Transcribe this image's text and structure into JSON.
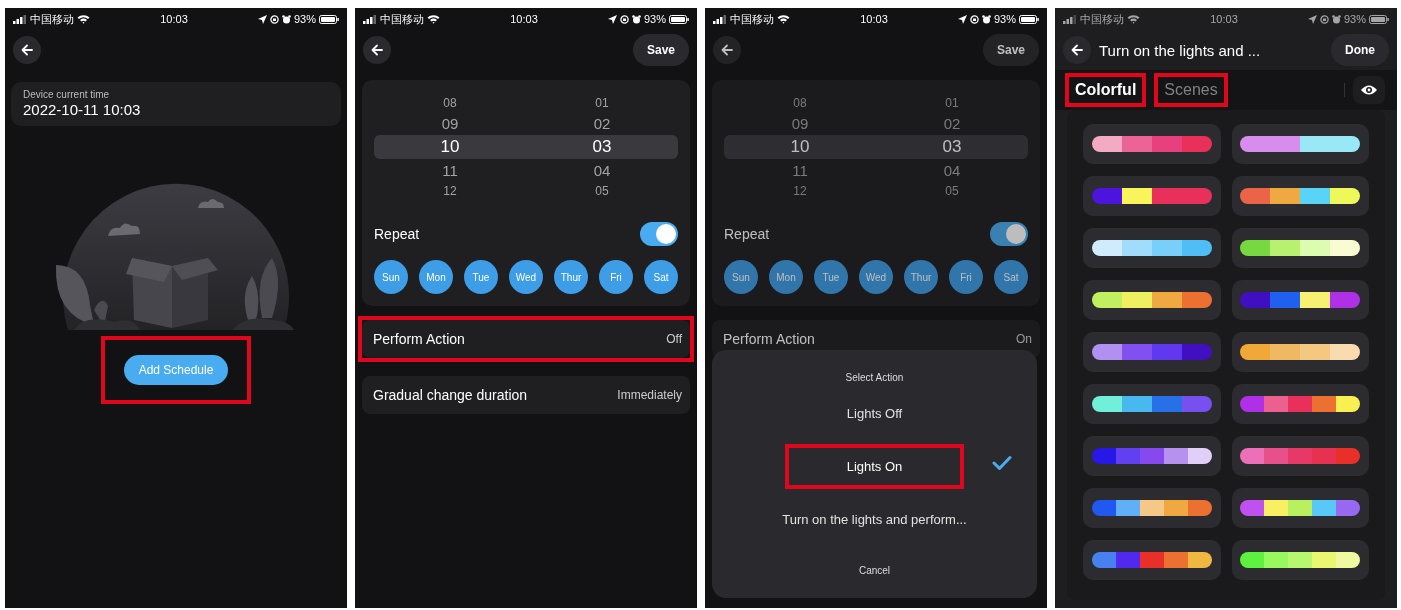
{
  "screens": [
    {
      "kind": "schedule_empty",
      "status_bar": {
        "carrier": "中国移动",
        "time": "10:03",
        "battery": "93%",
        "dimmed": false
      },
      "device_time": {
        "label": "Device current time",
        "value": "2022-10-11 10:03"
      },
      "add_button": {
        "label": "Add Schedule",
        "highlighted": true
      }
    },
    {
      "kind": "schedule_edit",
      "status_bar": {
        "carrier": "中国移动",
        "time": "10:03",
        "battery": "93%",
        "dimmed": false
      },
      "save_label": "Save",
      "picker": {
        "hours": [
          {
            "value": "08",
            "selected": false
          },
          {
            "value": "09",
            "selected": false
          },
          {
            "value": "10",
            "selected": true
          },
          {
            "value": "11",
            "selected": false
          },
          {
            "value": "12",
            "selected": false
          }
        ],
        "minutes": [
          {
            "value": "01",
            "selected": false
          },
          {
            "value": "02",
            "selected": false
          },
          {
            "value": "03",
            "selected": true
          },
          {
            "value": "04",
            "selected": false
          },
          {
            "value": "05",
            "selected": false
          }
        ]
      },
      "repeat": {
        "label": "Repeat",
        "on": true
      },
      "days": [
        {
          "label": "Sun",
          "selected": true
        },
        {
          "label": "Mon",
          "selected": true
        },
        {
          "label": "Tue",
          "selected": true
        },
        {
          "label": "Wed",
          "selected": true
        },
        {
          "label": "Thur",
          "selected": true
        },
        {
          "label": "Fri",
          "selected": true
        },
        {
          "label": "Sat",
          "selected": true
        }
      ],
      "rows": [
        {
          "label": "Perform Action",
          "value": "Off",
          "highlighted": true
        },
        {
          "label": "Gradual change duration",
          "value": "Immediately",
          "highlighted": false
        }
      ]
    },
    {
      "kind": "action_sheet",
      "status_bar": {
        "carrier": "中国移动",
        "time": "10:03",
        "battery": "93%",
        "dimmed": false
      },
      "save_label": "Save",
      "picker": {
        "hours": [
          {
            "value": "08",
            "selected": false
          },
          {
            "value": "09",
            "selected": false
          },
          {
            "value": "10",
            "selected": true
          },
          {
            "value": "11",
            "selected": false
          },
          {
            "value": "12",
            "selected": false
          }
        ],
        "minutes": [
          {
            "value": "01",
            "selected": false
          },
          {
            "value": "02",
            "selected": false
          },
          {
            "value": "03",
            "selected": true
          },
          {
            "value": "04",
            "selected": false
          },
          {
            "value": "05",
            "selected": false
          }
        ]
      },
      "repeat": {
        "label": "Repeat",
        "on": true
      },
      "days": [
        {
          "label": "Sun",
          "selected": true
        },
        {
          "label": "Mon",
          "selected": true
        },
        {
          "label": "Tue",
          "selected": true
        },
        {
          "label": "Wed",
          "selected": true
        },
        {
          "label": "Thur",
          "selected": true
        },
        {
          "label": "Fri",
          "selected": true
        },
        {
          "label": "Sat",
          "selected": true
        }
      ],
      "rows": [
        {
          "label": "Perform Action",
          "value": "On",
          "highlighted": false
        }
      ],
      "sheet": {
        "title": "Select Action",
        "options": [
          {
            "label": "Lights Off",
            "selected": false,
            "highlighted": false
          },
          {
            "label": "Lights On",
            "selected": true,
            "highlighted": true
          },
          {
            "label": "Turn on the lights and perform...",
            "selected": false,
            "highlighted": false
          }
        ],
        "cancel": "Cancel"
      }
    },
    {
      "kind": "palettes",
      "status_bar": {
        "carrier": "中国移动",
        "time": "10:03",
        "battery": "93%",
        "dimmed": true
      },
      "title": "Turn on the lights and ...",
      "done_label": "Done",
      "tabs": [
        {
          "label": "Colorful",
          "selected": true,
          "highlighted": true
        },
        {
          "label": "Scenes",
          "selected": false,
          "highlighted": true
        }
      ],
      "palettes": [
        {
          "segments": [
            {
              "color": "#f5aac4"
            },
            {
              "color": "#ec6494"
            },
            {
              "color": "#e8407c"
            },
            {
              "color": "#e8305a"
            }
          ]
        },
        {
          "segments": [
            {
              "color": "#d88cf0"
            },
            {
              "color": "#d88cf0"
            },
            {
              "color": "#98e8f8"
            },
            {
              "color": "#98e8f8"
            }
          ]
        },
        {
          "segments": [
            {
              "color": "#4c14dc"
            },
            {
              "color": "#f8f45a"
            },
            {
              "color": "#e8305a"
            },
            {
              "color": "#e8305a"
            }
          ]
        },
        {
          "segments": [
            {
              "color": "#ec6448"
            },
            {
              "color": "#f0a840"
            },
            {
              "color": "#58d4f8"
            },
            {
              "color": "#eef858"
            }
          ]
        },
        {
          "segments": [
            {
              "color": "#d0ecfc"
            },
            {
              "color": "#a0dcfc"
            },
            {
              "color": "#78d0fa"
            },
            {
              "color": "#50bef6"
            }
          ]
        },
        {
          "segments": [
            {
              "color": "#78d840"
            },
            {
              "color": "#b8f070"
            },
            {
              "color": "#dcfcb0"
            },
            {
              "color": "#f8fcd0"
            }
          ]
        },
        {
          "segments": [
            {
              "color": "#c0f060"
            },
            {
              "color": "#eef060"
            },
            {
              "color": "#f0a840"
            },
            {
              "color": "#ec7030"
            }
          ]
        },
        {
          "segments": [
            {
              "color": "#4010c0"
            },
            {
              "color": "#2060f0"
            },
            {
              "color": "#f8f070"
            },
            {
              "color": "#b030e8"
            }
          ]
        },
        {
          "segments": [
            {
              "color": "#b090f0"
            },
            {
              "color": "#8050f0"
            },
            {
              "color": "#6038f0"
            },
            {
              "color": "#4010c0"
            }
          ]
        },
        {
          "segments": [
            {
              "color": "#f0a838"
            },
            {
              "color": "#f0b860"
            },
            {
              "color": "#f4c880"
            },
            {
              "color": "#f8dcb0"
            }
          ]
        },
        {
          "segments": [
            {
              "color": "#70f0d8"
            },
            {
              "color": "#48b8f0"
            },
            {
              "color": "#2870e8"
            },
            {
              "color": "#7850f0"
            }
          ]
        },
        {
          "segments": [
            {
              "color": "#b030e8"
            },
            {
              "color": "#ec6090"
            },
            {
              "color": "#e8305a"
            },
            {
              "color": "#ec7030"
            },
            {
              "color": "#f8f050"
            }
          ]
        },
        {
          "segments": [
            {
              "color": "#2818e8"
            },
            {
              "color": "#6040f0"
            },
            {
              "color": "#8848f0"
            },
            {
              "color": "#b890f0"
            },
            {
              "color": "#e0d0f8"
            }
          ]
        },
        {
          "segments": [
            {
              "color": "#ec70b8"
            },
            {
              "color": "#e8508c"
            },
            {
              "color": "#e83868"
            },
            {
              "color": "#e83050"
            },
            {
              "color": "#e83028"
            }
          ]
        },
        {
          "segments": [
            {
              "color": "#2058f0"
            },
            {
              "color": "#60b0f8"
            },
            {
              "color": "#f6c888"
            },
            {
              "color": "#f0a840"
            },
            {
              "color": "#ec7030"
            }
          ]
        },
        {
          "segments": [
            {
              "color": "#c050f0"
            },
            {
              "color": "#f8f060"
            },
            {
              "color": "#b8f060"
            },
            {
              "color": "#58c8f8"
            },
            {
              "color": "#9868f0"
            }
          ]
        },
        {
          "segments": [
            {
              "color": "#4880f0"
            },
            {
              "color": "#5028f0"
            },
            {
              "color": "#e83028"
            },
            {
              "color": "#ec7030"
            },
            {
              "color": "#f0b840"
            }
          ]
        },
        {
          "segments": [
            {
              "color": "#60f040"
            },
            {
              "color": "#98f860"
            },
            {
              "color": "#b8f870"
            },
            {
              "color": "#e8f870"
            },
            {
              "color": "#f0f8a0"
            }
          ]
        }
      ]
    }
  ]
}
